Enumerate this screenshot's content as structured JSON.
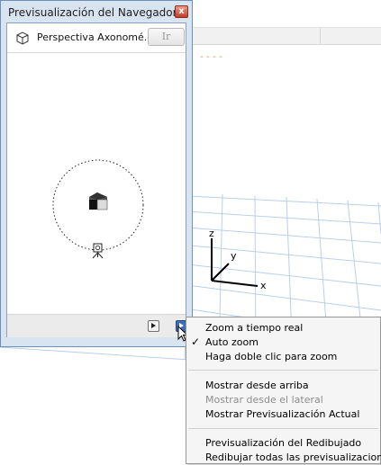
{
  "palette": {
    "title": "Previsualización del Navegador",
    "close_glyph": "x",
    "view_name": "Perspectiva Axonomé...",
    "go_label": "Ir",
    "icons": {
      "view": "axonometry-box-icon",
      "close": "close-icon",
      "house": "house-model-icon",
      "camera": "camera-icon",
      "prev": "play-small-icon",
      "more": "play-options-icon"
    }
  },
  "viewport": {
    "axes": {
      "x": "x",
      "y": "y",
      "z": "z"
    },
    "dash_marker": "----",
    "grid_color": "#b7cde8"
  },
  "menu": {
    "items": [
      {
        "label": "Zoom a tiempo real",
        "checked": false,
        "enabled": true
      },
      {
        "label": "Auto zoom",
        "checked": true,
        "enabled": true
      },
      {
        "label": "Haga doble clic para zoom",
        "checked": false,
        "enabled": true
      },
      {
        "label": "Mostrar desde arriba",
        "checked": false,
        "enabled": true
      },
      {
        "label": "Mostrar desde el lateral",
        "checked": false,
        "enabled": false
      },
      {
        "label": "Mostrar Previsualización Actual",
        "checked": false,
        "enabled": true
      },
      {
        "label": "Previsualización del Redibujado",
        "checked": false,
        "enabled": true
      },
      {
        "label": "Redibujar todas las previsualizaciones",
        "checked": false,
        "enabled": true
      }
    ],
    "check_glyph": "✓"
  }
}
